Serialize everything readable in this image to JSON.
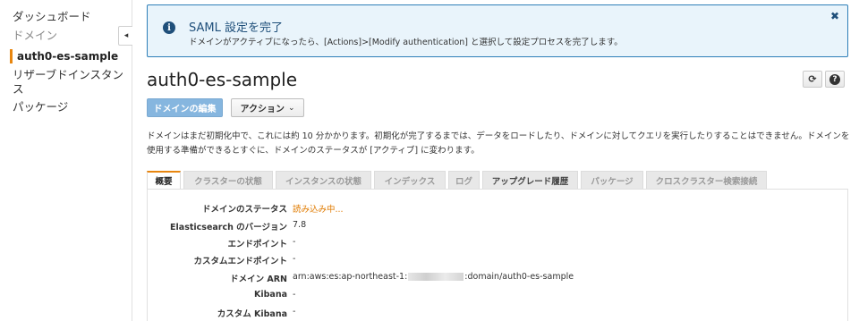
{
  "sidebar": {
    "items": [
      {
        "label": "ダッシュボード",
        "state": "normal"
      },
      {
        "label": "ドメイン",
        "state": "muted"
      },
      {
        "label": "auth0-es-sample",
        "state": "active"
      },
      {
        "label": "リザーブドインスタンス",
        "state": "normal"
      },
      {
        "label": "パッケージ",
        "state": "normal"
      }
    ],
    "collapse_glyph": "◂"
  },
  "alert": {
    "icon": "info-icon",
    "title": "SAML 設定を完了",
    "body": "ドメインがアクティブになったら、[Actions]>[Modify authentication] と選択して設定プロセスを完了します。",
    "close_glyph": "✖"
  },
  "header": {
    "title": "auth0-es-sample",
    "refresh_glyph": "⟳",
    "help_glyph": "?"
  },
  "toolbar": {
    "edit_label": "ドメインの編集",
    "actions_label": "アクション",
    "actions_chevron": "⌄"
  },
  "description": "ドメインはまだ初期化中で、これには約 10 分かかります。初期化が完了するまでは、データをロードしたり、ドメインに対してクエリを実行したりすることはできません。ドメインを使用する準備ができるとすぐに、ドメインのステータスが [アクティブ] に変わります。",
  "tabs": [
    {
      "label": "概要",
      "state": "active"
    },
    {
      "label": "クラスターの状態",
      "state": "normal"
    },
    {
      "label": "インスタンスの状態",
      "state": "normal"
    },
    {
      "label": "インデックス",
      "state": "normal"
    },
    {
      "label": "ログ",
      "state": "normal"
    },
    {
      "label": "アップグレード履歴",
      "state": "dark"
    },
    {
      "label": "パッケージ",
      "state": "normal"
    },
    {
      "label": "クロスクラスター検索接続",
      "state": "normal"
    }
  ],
  "details": [
    {
      "label": "ドメインのステータス",
      "value": "読み込み中..."
    },
    {
      "label": "Elasticsearch のバージョン",
      "value": "7.8"
    },
    {
      "label": "エンドポイント",
      "value": "-"
    },
    {
      "label": "カスタムエンドポイント",
      "value": "-"
    },
    {
      "label": "ドメイン ARN",
      "value_prefix": "arn:aws:es:ap-northeast-1:",
      "value_suffix": ":domain/auth0-es-sample"
    },
    {
      "label": "Kibana",
      "value": "-"
    },
    {
      "label": "カスタム Kibana",
      "value": "-"
    }
  ],
  "colors": {
    "accent": "#e8860f",
    "alert_border": "#2e7fb8",
    "alert_bg": "#e9f4fb",
    "primary_button": "#86b6df",
    "loading_text": "#e07b00"
  }
}
